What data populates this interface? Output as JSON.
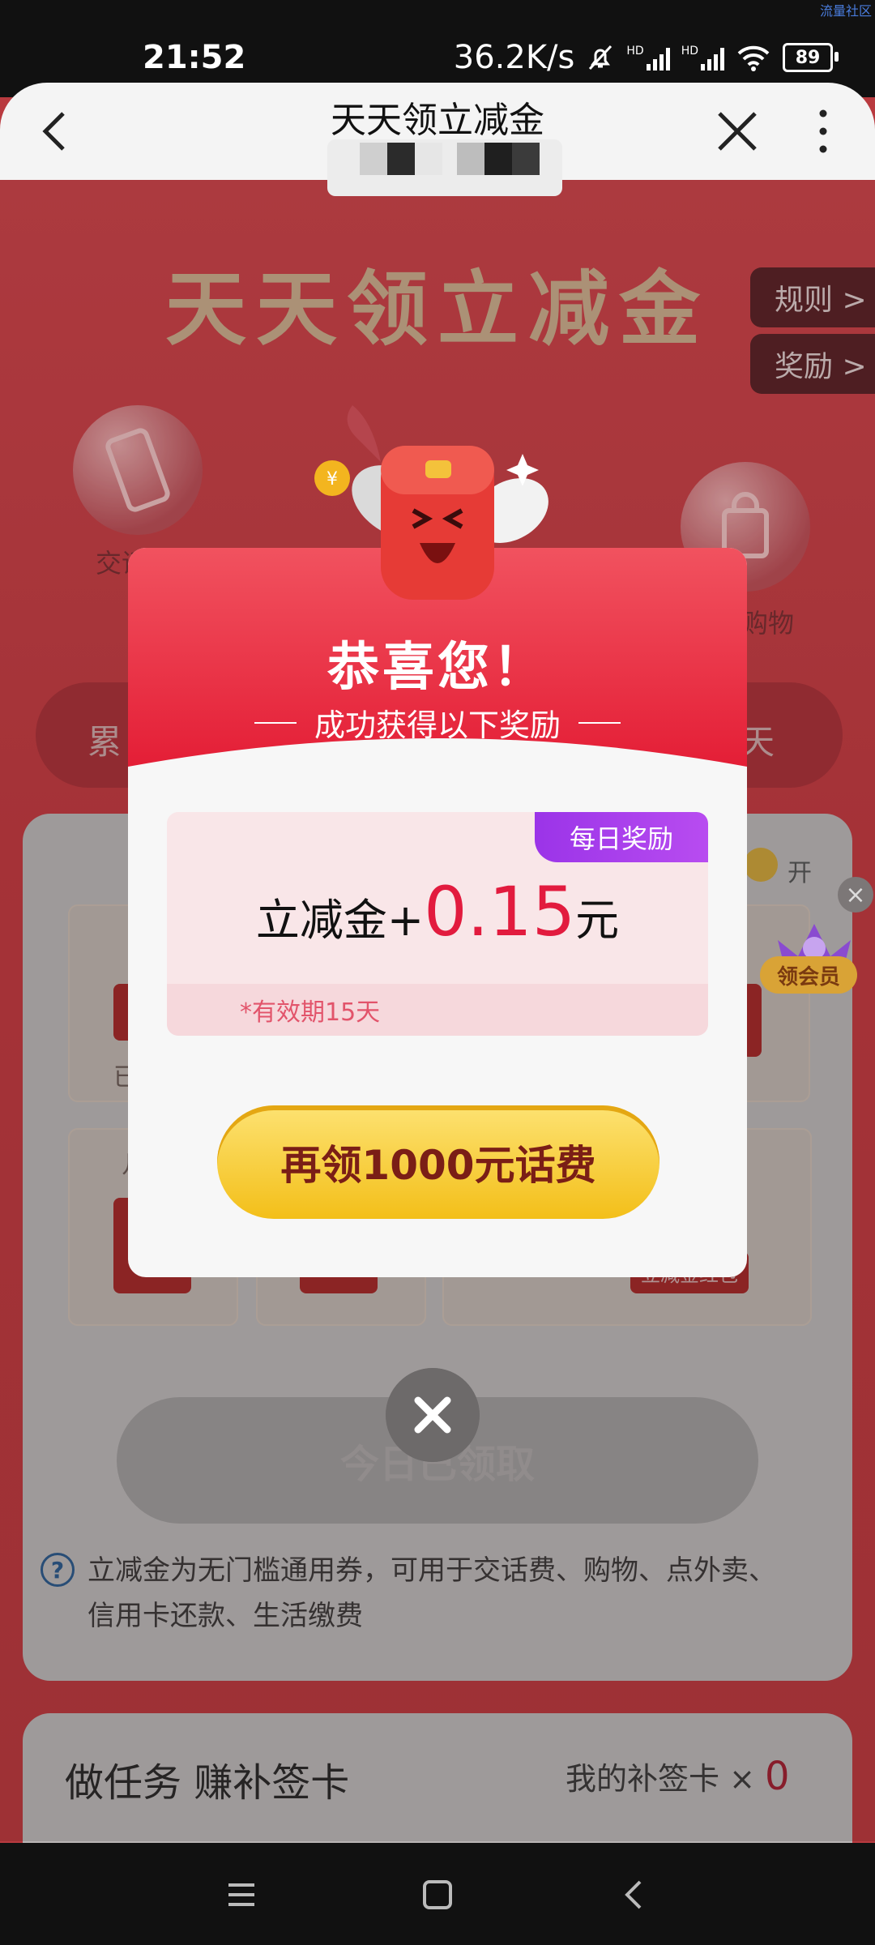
{
  "status": {
    "time": "21:52",
    "net_speed": "36.2K/s",
    "battery": "89",
    "corner_tag": "流量社区",
    "hd1": "HD",
    "hd2": "HD"
  },
  "header": {
    "title": "天天领立减金"
  },
  "background": {
    "big_title": "天天领立减金",
    "rules_label": "规则 >",
    "rewards_label": "奖励 >",
    "bubble_left_label": "交话",
    "bubble_right_label": "购物",
    "pill_left": "累",
    "pill_right": "天",
    "toggle_label": "开",
    "card_left_text": "已",
    "card_bottom_left_text": "几",
    "card_bottom_right_text": "立减金红包",
    "claimed_button": "今日已领取",
    "info_text": "立减金为无门槛通用券，可用于交话费、购物、点外卖、信用卡还款、生活缴费",
    "task_title": "做任务 赚补签卡",
    "task_card_label": "我的补签卡 ×",
    "task_card_count": "0"
  },
  "vip": {
    "label": "领会员"
  },
  "modal": {
    "title": "恭喜您！",
    "subtitle": "成功获得以下奖励",
    "tag": "每日奖励",
    "amount_prefix": "立减金+",
    "amount_value": "0.15",
    "amount_unit": "元",
    "validity": "*有效期15天",
    "cta": "再领1000元话费"
  },
  "colors": {
    "brand_red": "#e21b3e",
    "cta_yellow": "#f3bf19",
    "tag_purple": "#9b34e8"
  }
}
